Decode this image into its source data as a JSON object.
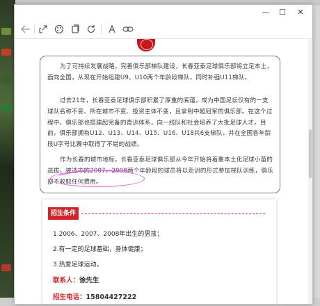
{
  "window": {
    "controls": {
      "minimize": "—",
      "maximize": "☐",
      "close": "✕"
    }
  },
  "toolbar": {
    "icons": [
      "back-arrow-icon",
      "share-icon",
      "palette-icon",
      "copy-icon",
      "refresh-icon",
      "text-icon",
      "link-icon"
    ]
  },
  "article": {
    "p1": "为了可持续发展战略，完善俱乐部梯队建设，长春亚泰足球俱乐部将立足本土，面向全国，从现在开始组建U9、U10两个年龄段梯队，同时补强U11梯队。",
    "p2": "过去21年，长春亚泰足球俱乐部积累了厚重的底蕴，成为中国足坛仅有的一支球队名称不变、所在城市不变、投资主体不变，且拿到中超冠军的俱乐部。在这个过程中，俱乐部也搭建起完备的青训体系，向一线队和社会培养了大批足球人才。目前，俱乐部拥有U12、U13、U14、U15、U16、U18共6支梯队，并在全国各年龄段U字号比赛中取得了不错的战绩。",
    "p3": "作为长春的城市地标，长春亚泰足球俱乐部从今年开始将着重本土化足球小苗的选拔，被选中的2007、2008两个年龄段的球员将以走训的形式参加梯队训练，俱乐部不收取任何费用。"
  },
  "recruit": {
    "tag": "招生条件",
    "items": [
      "1.2006、2007、2008年出生的男孩；",
      "2.有一定的足球基础，身体健康；",
      "3.热爱足球运动。"
    ],
    "contact_label": "联系人：",
    "contact_name": "徐先生",
    "phone_label": "招生电话：",
    "phone_value": "15804427222"
  },
  "colors": {
    "accent": "#d2232a",
    "highlight_ellipse": "#e35ee0"
  }
}
